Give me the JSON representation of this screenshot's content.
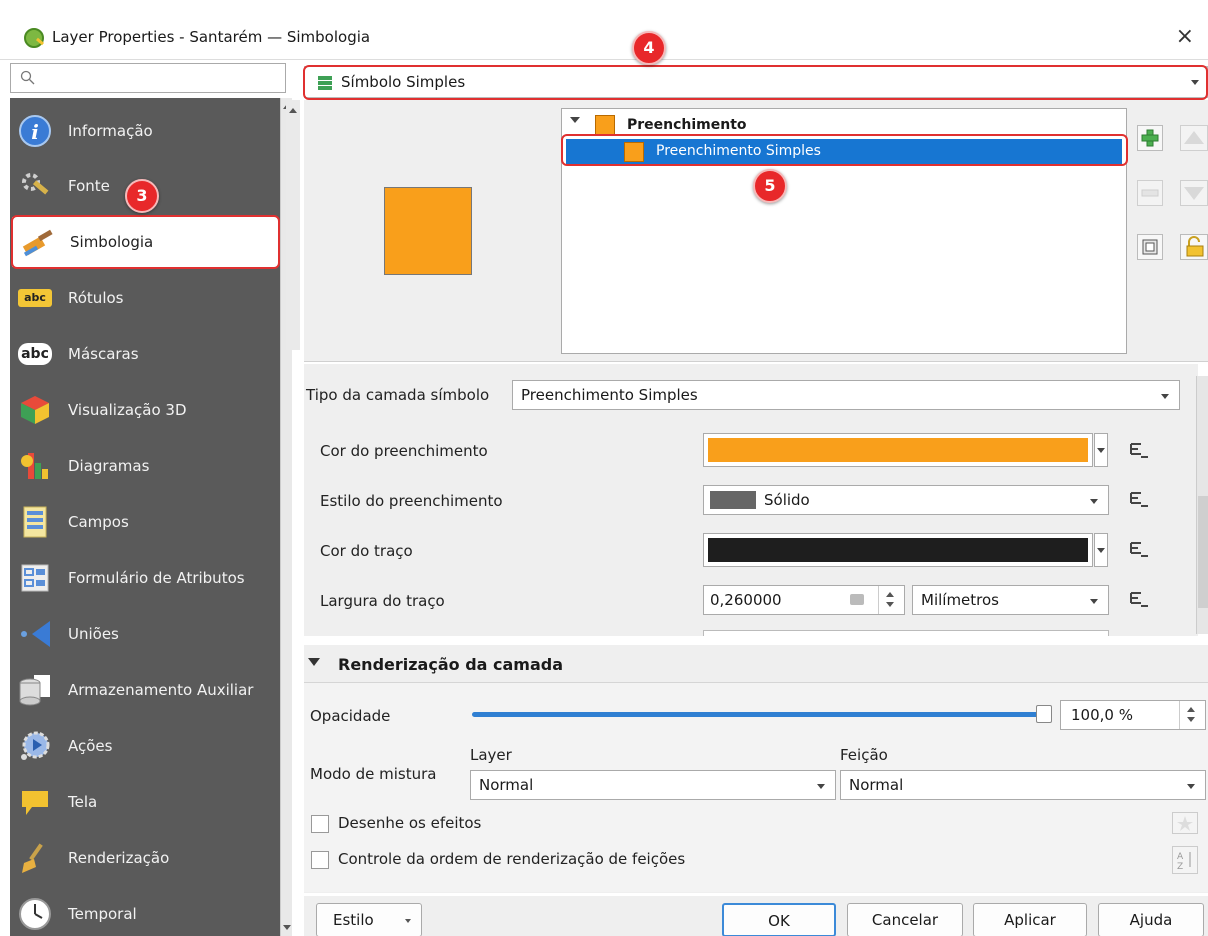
{
  "window": {
    "title": "Layer Properties - Santarém — Simbologia",
    "close": "×"
  },
  "callouts": {
    "c3": "3",
    "c4": "4",
    "c5": "5"
  },
  "search": {
    "placeholder": ""
  },
  "sidebar": {
    "items": [
      {
        "label": "Informação",
        "icon": "info-icon"
      },
      {
        "label": "Fonte",
        "icon": "source-icon"
      },
      {
        "label": "Simbologia",
        "icon": "symbology-icon"
      },
      {
        "label": "Rótulos",
        "icon": "labels-icon"
      },
      {
        "label": "Máscaras",
        "icon": "masks-icon"
      },
      {
        "label": "Visualização 3D",
        "icon": "3d-icon"
      },
      {
        "label": "Diagramas",
        "icon": "diagrams-icon"
      },
      {
        "label": "Campos",
        "icon": "fields-icon"
      },
      {
        "label": "Formulário de Atributos",
        "icon": "attributes-form-icon"
      },
      {
        "label": "Uniões",
        "icon": "joins-icon"
      },
      {
        "label": "Armazenamento Auxiliar",
        "icon": "storage-icon"
      },
      {
        "label": "Ações",
        "icon": "actions-icon"
      },
      {
        "label": "Tela",
        "icon": "display-icon"
      },
      {
        "label": "Renderização",
        "icon": "rendering-icon"
      },
      {
        "label": "Temporal",
        "icon": "temporal-icon"
      }
    ],
    "active_index": 2,
    "abc1": "abc",
    "abc2": "abc"
  },
  "symbol_type": {
    "value": "Símbolo Simples"
  },
  "tree": {
    "parent": "Preenchimento",
    "child": "Preenchimento Simples"
  },
  "symbol_layer": {
    "type_label": "Tipo da camada símbolo",
    "type_value": "Preenchimento Simples",
    "fill_color_label": "Cor do preenchimento",
    "fill_color": "#f99f1b",
    "fill_style_label": "Estilo do preenchimento",
    "fill_style_value": "Sólido",
    "stroke_color_label": "Cor do traço",
    "stroke_color": "#1e1e1e",
    "stroke_width_label": "Largura do traço",
    "stroke_width_value": "0,260000",
    "stroke_width_unit": "Milímetros"
  },
  "rendering": {
    "header": "Renderização da camada",
    "opacity_label": "Opacidade",
    "opacity_value": "100,0 %",
    "opacity_fraction": 1.0,
    "blend_label": "Modo de mistura",
    "layer_label": "Layer",
    "layer_value": "Normal",
    "feature_label": "Feição",
    "feature_value": "Normal",
    "draw_effects_label": "Desenhe os efeitos",
    "order_label": "Controle da ordem de renderização de feições"
  },
  "footer": {
    "style": "Estilo",
    "ok": "OK",
    "cancel": "Cancelar",
    "apply": "Aplicar",
    "help": "Ajuda"
  },
  "colors": {
    "accent": "#1776d2",
    "callout": "#e8282a",
    "sidebar_bg": "#5a5a5a"
  }
}
